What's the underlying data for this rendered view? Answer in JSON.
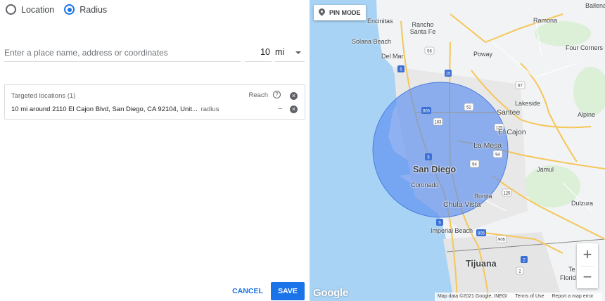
{
  "location_type": {
    "options": [
      {
        "label": "Location",
        "selected": false
      },
      {
        "label": "Radius",
        "selected": true
      }
    ]
  },
  "search": {
    "placeholder": "Enter a place name, address or coordinates",
    "value": ""
  },
  "radius": {
    "value": "10",
    "unit": "mi"
  },
  "targeted": {
    "header": "Targeted locations (1)",
    "reach_label": "Reach",
    "help_icon": "help-icon",
    "rows": [
      {
        "text": "10 mi around 2110 El Cajon Blvd, San Diego, CA 92104, Unit...",
        "suffix": "radius",
        "reach": "–"
      }
    ]
  },
  "actions": {
    "cancel": "CANCEL",
    "save": "SAVE"
  },
  "map": {
    "pin_mode_label": "PIN MODE",
    "places": {
      "ballena": "Ballena",
      "encinitas": "Encinitas",
      "rancho_santa_fe": "Rancho Santa Fe",
      "ramona": "Ramona",
      "solana_beach": "Solana Beach",
      "del_mar": "Del Mar",
      "poway": "Poway",
      "four_corners": "Four Corners",
      "lakeside": "Lakeside",
      "santee": "Santee",
      "alpine": "Alpine",
      "el_cajon": "El Cajon",
      "la_mesa": "La Mesa",
      "san_diego": "San Diego",
      "jamul": "Jamul",
      "coronado": "Coronado",
      "bonita": "Bonita",
      "chula_vista": "Chula Vista",
      "dulzura": "Dulzura",
      "imperial_beach": "Imperial Beach",
      "tijuana": "Tijuana",
      "tecate_partial": "Te",
      "florida_partial": "Florid"
    },
    "google_logo": "Google",
    "attribution": {
      "data": "Map data ©2021 Google, INEGI",
      "terms": "Terms of Use",
      "report": "Report a map error"
    },
    "zoom_in": "+",
    "zoom_out": "−",
    "radius_circle_color": "#5b8def",
    "water_color": "#a8d3f5",
    "land_color": "#f1f3f4"
  }
}
